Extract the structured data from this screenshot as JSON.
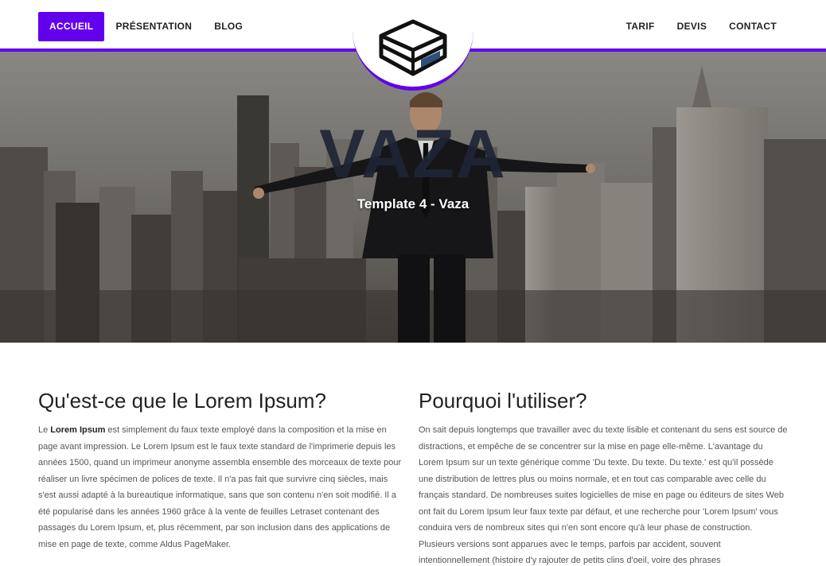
{
  "nav": {
    "left": [
      "ACCUEIL",
      "PRÉSENTATION",
      "BLOG"
    ],
    "right": [
      "TARIF",
      "DEVIS",
      "CONTACT"
    ],
    "active": "ACCUEIL"
  },
  "logo": {
    "icon": "brick-box-icon"
  },
  "hero": {
    "title": "VAZA",
    "subtitle": "Template 4 - Vaza"
  },
  "left_col": {
    "title": "Qu'est-ce que le Lorem Ipsum?",
    "lead_bold": "Lorem Ipsum",
    "lead_prefix": "Le ",
    "body": " est simplement du faux texte employé dans la composition et la mise en page avant impression. Le Lorem Ipsum est le faux texte standard de l'imprimerie depuis les années 1500, quand un imprimeur anonyme assembla ensemble des morceaux de texte pour réaliser un livre spécimen de polices de texte. Il n'a pas fait que survivre cinq siècles, mais s'est aussi adapté à la bureautique informatique, sans que son contenu n'en soit modifié. Il a été popularisé dans les années 1960 grâce à la vente de feuilles Letraset contenant des passages du Lorem Ipsum, et, plus récemment, par son inclusion dans des applications de mise en page de texte, comme Aldus PageMaker."
  },
  "right_col": {
    "title": "Pourquoi l'utiliser?",
    "body": "On sait depuis longtemps que travailler avec du texte lisible et contenant du sens est source de distractions, et empêche de se concentrer sur la mise en page elle-même. L'avantage du Lorem Ipsum sur un texte générique comme 'Du texte. Du texte. Du texte.' est qu'il possède une distribution de lettres plus ou moins normale, et en tout cas comparable avec celle du français standard. De nombreuses suites logicielles de mise en page ou éditeurs de sites Web ont fait du Lorem Ipsum leur faux texte par défaut, et une recherche pour 'Lorem Ipsum' vous conduira vers de nombreux sites qui n'en sont encore qu'à leur phase de construction. Plusieurs versions sont apparues avec le temps, parfois par accident, souvent intentionnellement (histoire d'y rajouter de petits clins d'oeil, voire des phrases embarassantes)."
  },
  "colors": {
    "accent": "#6200ee",
    "hero_title": "#1f2535"
  }
}
